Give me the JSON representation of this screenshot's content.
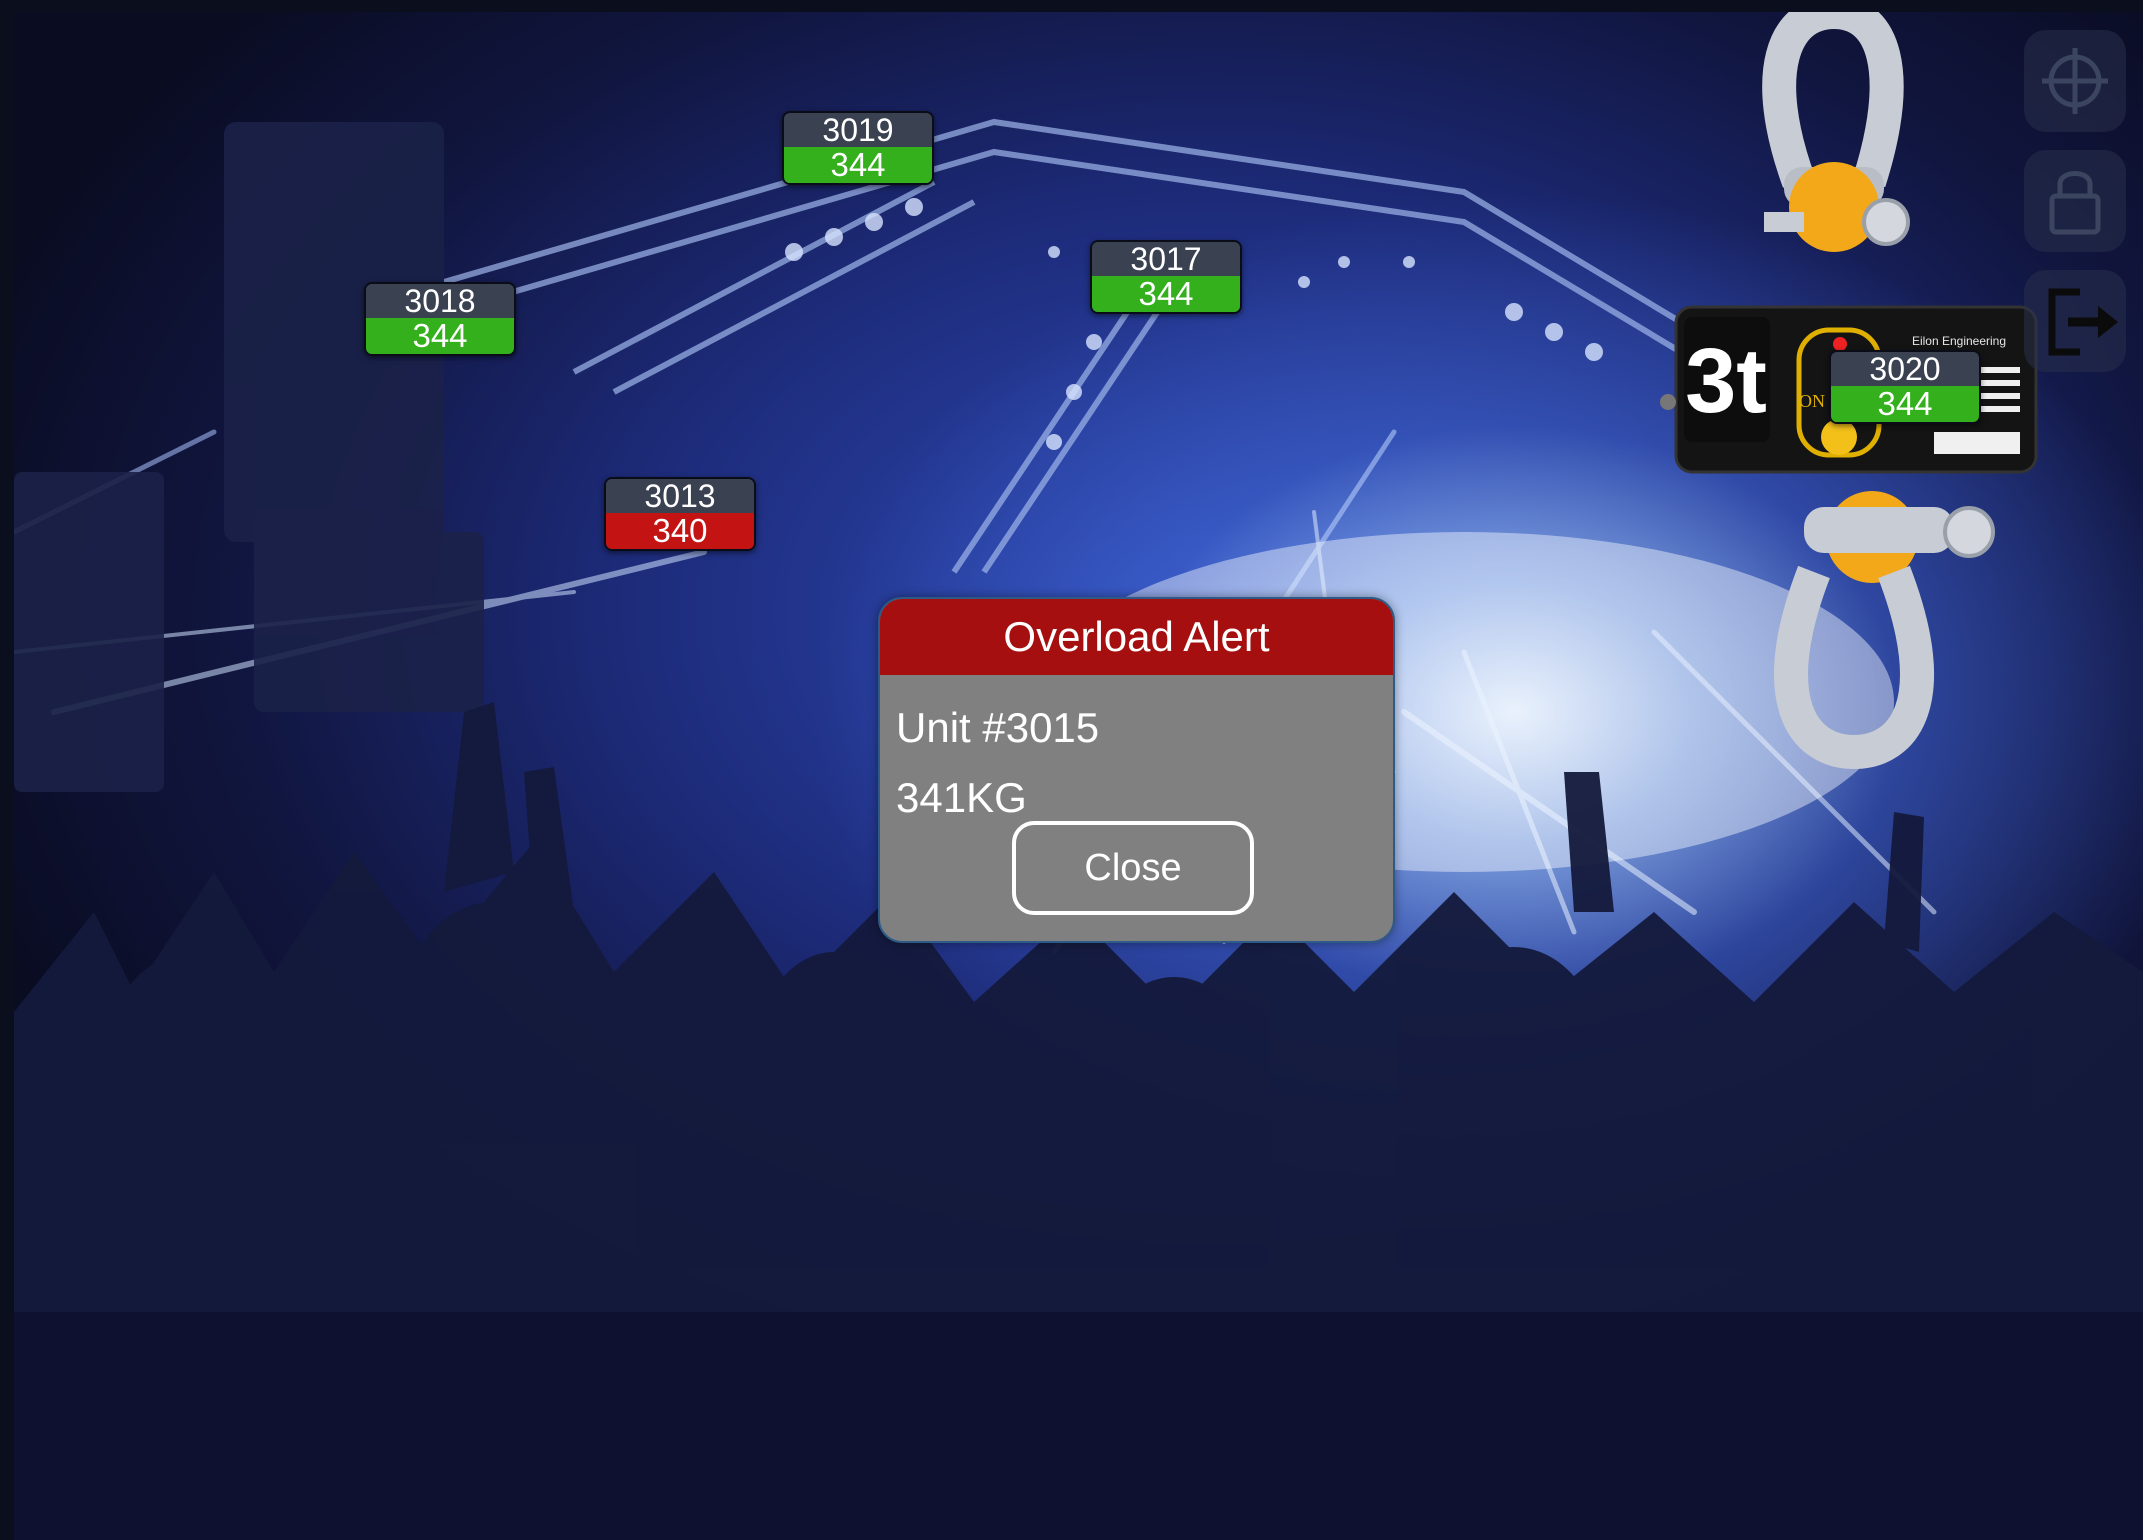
{
  "units": [
    {
      "id": "3019",
      "value": "344",
      "status": "ok"
    },
    {
      "id": "3018",
      "value": "344",
      "status": "ok"
    },
    {
      "id": "3017",
      "value": "344",
      "status": "ok"
    },
    {
      "id": "3013",
      "value": "340",
      "status": "alarm"
    },
    {
      "id": "3020",
      "value": "344",
      "status": "ok"
    }
  ],
  "alert": {
    "title": "Overload Alert",
    "unit_line": "Unit #3015",
    "weight_line": "341KG",
    "close_label": "Close"
  },
  "device": {
    "capacity_label": "3t",
    "brand_text": "Eilon Engineering",
    "on_label": "ON"
  },
  "side_buttons": [
    "crosshair-icon",
    "lock-icon",
    "logout-icon"
  ],
  "colors": {
    "ok": "#33b01c",
    "alarm": "#c41313",
    "tag_header": "#3a4252",
    "alert_header": "#a50f0f",
    "dialog_body": "#808080"
  }
}
